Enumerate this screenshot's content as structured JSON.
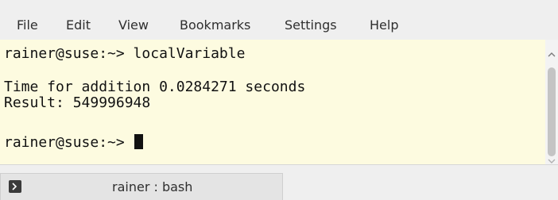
{
  "menu": {
    "file": "File",
    "edit": "Edit",
    "view": "View",
    "bookmarks": "Bookmarks",
    "settings": "Settings",
    "help": "Help"
  },
  "terminal": {
    "line1": "rainer@suse:~> localVariable",
    "line2": "Time for addition 0.0284271 seconds",
    "line3": "Result: 549996948",
    "prompt": "rainer@suse:~> "
  },
  "tab": {
    "label": "rainer : bash",
    "icon": "terminal-icon"
  },
  "colors": {
    "terminal_bg": "#fdfbe0",
    "chrome_bg": "#efefef",
    "text": "#111111"
  }
}
